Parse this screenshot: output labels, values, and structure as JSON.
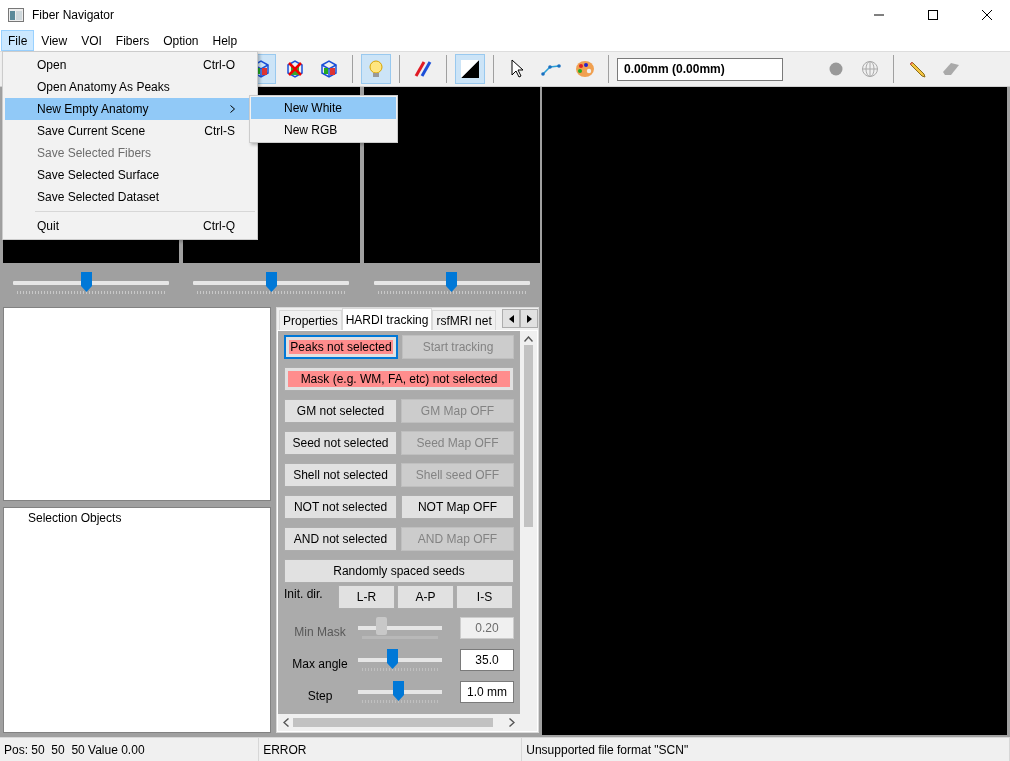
{
  "window": {
    "title": "Fiber Navigator"
  },
  "menubar": [
    {
      "label": "File",
      "selected": true
    },
    {
      "label": "View",
      "selected": false
    },
    {
      "label": "VOI",
      "selected": false
    },
    {
      "label": "Fibers",
      "selected": false
    },
    {
      "label": "Option",
      "selected": false
    },
    {
      "label": "Help",
      "selected": false
    }
  ],
  "file_menu": [
    {
      "kind": "item",
      "label": "Open",
      "shortcut": "Ctrl-O",
      "disabled": false,
      "highlighted": false
    },
    {
      "kind": "item",
      "label": "Open Anatomy As Peaks",
      "disabled": false,
      "highlighted": false
    },
    {
      "kind": "submenu",
      "label": "New Empty Anatomy",
      "disabled": false,
      "highlighted": true
    },
    {
      "kind": "item",
      "label": "Save Current Scene",
      "shortcut": "Ctrl-S",
      "disabled": false,
      "highlighted": false
    },
    {
      "kind": "item",
      "label": "Save Selected Fibers",
      "disabled": true,
      "highlighted": false
    },
    {
      "kind": "item",
      "label": "Save Selected Surface",
      "disabled": false,
      "highlighted": false
    },
    {
      "kind": "item",
      "label": "Save Selected Dataset",
      "disabled": false,
      "highlighted": false
    },
    {
      "kind": "separator"
    },
    {
      "kind": "item",
      "label": "Quit",
      "shortcut": "Ctrl-Q",
      "disabled": false,
      "highlighted": false
    }
  ],
  "submenu": [
    {
      "label": "New White",
      "highlighted": true
    },
    {
      "label": "New RGB",
      "highlighted": false
    }
  ],
  "toolbar": [
    {
      "kind": "cube",
      "selected": true
    },
    {
      "kind": "cube-cross",
      "selected": false
    },
    {
      "kind": "cube",
      "selected": false
    },
    {
      "kind": "separator"
    },
    {
      "kind": "bulb",
      "selected": true
    },
    {
      "kind": "separator"
    },
    {
      "kind": "pens",
      "selected": false
    },
    {
      "kind": "separator"
    },
    {
      "kind": "contrast",
      "selected": true
    },
    {
      "kind": "separator"
    },
    {
      "kind": "cursor",
      "selected": false
    },
    {
      "kind": "polyline",
      "selected": false
    },
    {
      "kind": "palette",
      "selected": false
    },
    {
      "kind": "separator"
    },
    {
      "kind": "field",
      "value": "0.00mm (0.00mm)"
    },
    {
      "kind": "dot",
      "selected": false
    },
    {
      "kind": "globe",
      "selected": false
    },
    {
      "kind": "separator"
    },
    {
      "kind": "pencil",
      "selected": false
    },
    {
      "kind": "eraser",
      "selected": false
    }
  ],
  "view_sliders": [
    {
      "level": 0.47
    },
    {
      "level": 0.5
    },
    {
      "level": 0.5
    }
  ],
  "tree": {
    "items": [
      {
        "label": "Selection Objects"
      }
    ]
  },
  "tabs": [
    {
      "label": "Properties",
      "selected": false
    },
    {
      "label": "HARDI tracking",
      "selected": true
    },
    {
      "label": "rsfMRI net",
      "selected": false
    }
  ],
  "tracking": {
    "rows": [
      {
        "kind": "buttons",
        "buttons": [
          {
            "label": "Peaks not selected",
            "alert": true,
            "disabled": false,
            "focused": true
          },
          {
            "label": "Start tracking",
            "alert": false,
            "disabled": true,
            "focused": false
          }
        ]
      },
      {
        "kind": "buttons",
        "buttons": [
          {
            "label": "Mask (e.g. WM, FA, etc) not selected",
            "alert": true,
            "disabled": false,
            "focused": false
          }
        ]
      },
      {
        "kind": "buttons",
        "buttons": [
          {
            "label": "GM not selected",
            "alert": false,
            "disabled": false,
            "focused": false
          },
          {
            "label": "GM Map OFF",
            "alert": false,
            "disabled": true,
            "focused": false
          }
        ]
      },
      {
        "kind": "buttons",
        "buttons": [
          {
            "label": "Seed not selected",
            "alert": false,
            "disabled": false,
            "focused": false
          },
          {
            "label": "Seed Map OFF",
            "alert": false,
            "disabled": true,
            "focused": false
          }
        ]
      },
      {
        "kind": "buttons",
        "buttons": [
          {
            "label": "Shell not selected",
            "alert": false,
            "disabled": false,
            "focused": false
          },
          {
            "label": "Shell seed OFF",
            "alert": false,
            "disabled": true,
            "focused": false
          }
        ]
      },
      {
        "kind": "buttons",
        "buttons": [
          {
            "label": "NOT not selected",
            "alert": false,
            "disabled": false,
            "focused": false
          },
          {
            "label": "NOT Map OFF",
            "alert": false,
            "disabled": false,
            "focused": false
          }
        ]
      },
      {
        "kind": "buttons",
        "buttons": [
          {
            "label": "AND not selected",
            "alert": false,
            "disabled": false,
            "focused": false
          },
          {
            "label": "AND Map OFF",
            "alert": false,
            "disabled": true,
            "focused": false
          }
        ]
      },
      {
        "kind": "buttons",
        "buttons": [
          {
            "label": "Randomly spaced seeds",
            "alert": false,
            "disabled": false,
            "focused": false
          }
        ]
      },
      {
        "kind": "direction",
        "label": "Init. dir.",
        "buttons": [
          {
            "label": "L-R"
          },
          {
            "label": "A-P"
          },
          {
            "label": "I-S"
          }
        ]
      },
      {
        "kind": "param",
        "label": "Min Mask",
        "disabled": true,
        "level": 0.25,
        "value": "0.20"
      },
      {
        "kind": "param",
        "label": "Max angle",
        "disabled": false,
        "level": 0.4,
        "value": "35.0"
      },
      {
        "kind": "param",
        "label": "Step",
        "disabled": false,
        "level": 0.48,
        "value": "1.0 mm"
      }
    ]
  },
  "status_bar": [
    "Pos: 50  50  50 Value 0.00",
    "ERROR",
    "Unsupported file format \"SCN\""
  ]
}
